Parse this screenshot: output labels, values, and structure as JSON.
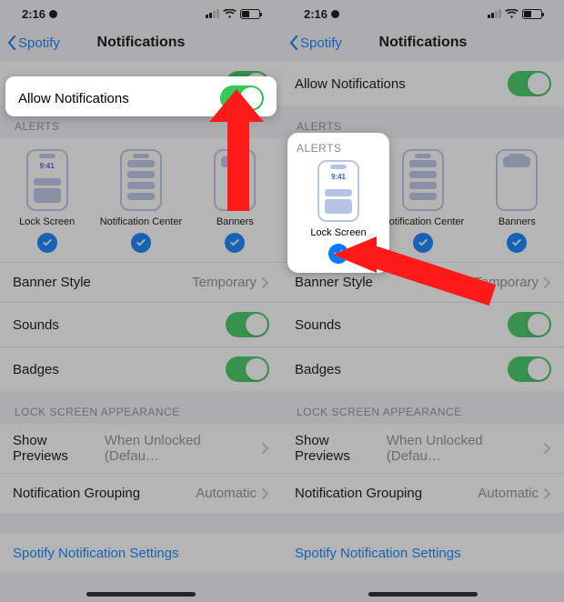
{
  "status": {
    "time": "2:16",
    "device_time": "9:41"
  },
  "nav": {
    "back_label": "Spotify",
    "title": "Notifications"
  },
  "allow": {
    "label": "Allow Notifications"
  },
  "alerts": {
    "section": "ALERTS",
    "lock": "Lock Screen",
    "nc": "Notification Center",
    "banners": "Banners"
  },
  "rows": {
    "banner_style": {
      "label": "Banner Style",
      "value": "Temporary"
    },
    "sounds": {
      "label": "Sounds"
    },
    "badges": {
      "label": "Badges"
    }
  },
  "appearance": {
    "section": "LOCK SCREEN APPEARANCE",
    "previews": {
      "label": "Show Previews",
      "value": "When Unlocked (Defau…"
    },
    "grouping": {
      "label": "Notification Grouping",
      "value": "Automatic"
    }
  },
  "footer": {
    "app_settings": "Spotify Notification Settings"
  }
}
